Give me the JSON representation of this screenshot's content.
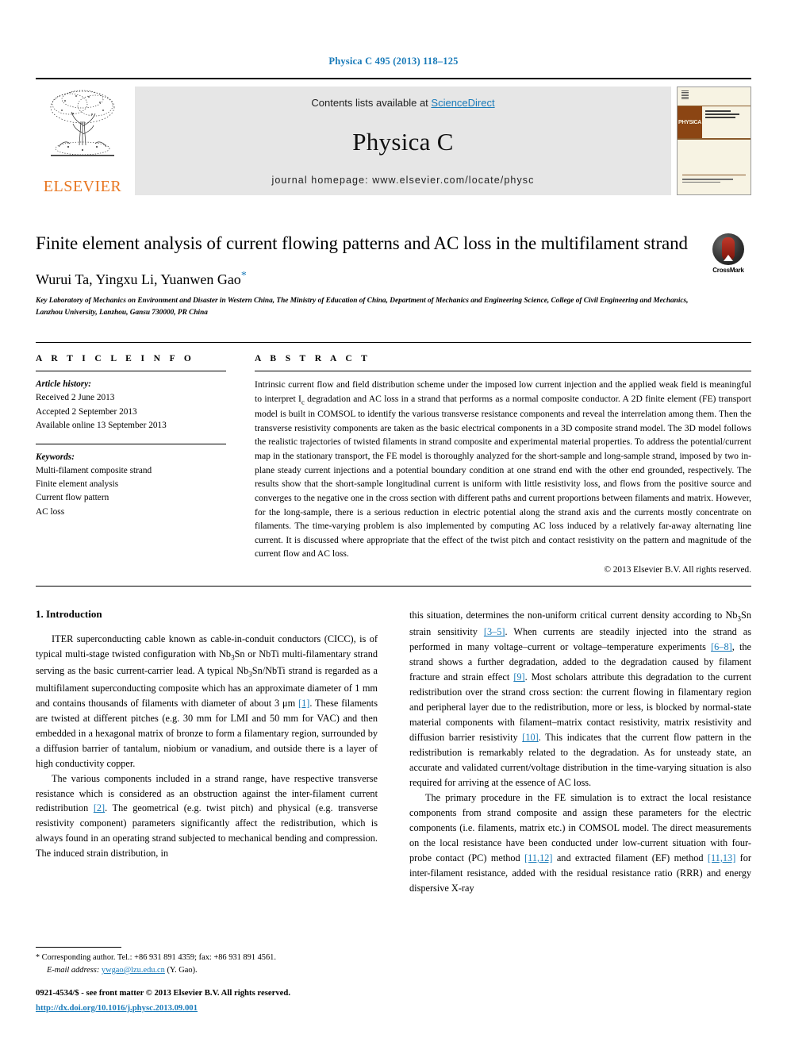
{
  "running_head": "Physica C 495 (2013) 118–125",
  "masthead": {
    "publisher": "ELSEVIER",
    "contents_prefix": "Contents lists available at ",
    "sciencedirect": "ScienceDirect",
    "journal_title": "Physica C",
    "homepage": "journal homepage: www.elsevier.com/locate/physc",
    "cover_brand": "PHYSICA",
    "accent_blue": "#1a7bb9",
    "elsevier_orange": "#E87722",
    "cover_brown": "#8B4513"
  },
  "article": {
    "title": "Finite element analysis of current flowing patterns and AC loss in the multifilament strand",
    "authors": "Wurui Ta, Yingxu Li, Yuanwen Gao",
    "corresponding_marker": "*",
    "affiliation": "Key Laboratory of Mechanics on Environment and Disaster in Western China, The Ministry of Education of China, Department of Mechanics and Engineering Science, College of Civil Engineering and Mechanics, Lanzhou University, Lanzhou, Gansu 730000, PR China",
    "crossmark_label": "CrossMark"
  },
  "article_info": {
    "heading": "A R T I C L E    I N F O",
    "history_label": "Article history:",
    "history": [
      "Received 2 June 2013",
      "Accepted 2 September 2013",
      "Available online 13 September 2013"
    ],
    "keywords_label": "Keywords:",
    "keywords": [
      "Multi-filament composite strand",
      "Finite element analysis",
      "Current flow pattern",
      "AC loss"
    ]
  },
  "abstract": {
    "heading": "A B S T R A C T",
    "part1": "Intrinsic current flow and field distribution scheme under the imposed low current injection and the applied weak field is meaningful to interpret I",
    "sub1": "c",
    "part2": " degradation and AC loss in a strand that performs as a normal composite conductor. A 2D finite element (FE) transport model is built in COMSOL to identify the various transverse resistance components and reveal the interrelation among them. Then the transverse resistivity components are taken as the basic electrical components in a 3D composite strand model. The 3D model follows the realistic trajectories of twisted filaments in strand composite and experimental material properties. To address the potential/current map in the stationary transport, the FE model is thoroughly analyzed for the short-sample and long-sample strand, imposed by two in-plane steady current injections and a potential boundary condition at one strand end with the other end grounded, respectively. The results show that the short-sample longitudinal current is uniform with little resistivity loss, and flows from the positive source and converges to the negative one in the cross section with different paths and current proportions between filaments and matrix. However, for the long-sample, there is a serious reduction in electric potential along the strand axis and the currents mostly concentrate on filaments. The time-varying problem is also implemented by computing AC loss induced by a relatively far-away alternating line current. It is discussed where appropriate that the effect of the twist pitch and contact resistivity on the pattern and magnitude of the current flow and AC loss.",
    "copyright": "© 2013 Elsevier B.V. All rights reserved."
  },
  "introduction": {
    "heading": "1. Introduction",
    "left_p1_a": "ITER superconducting cable known as cable-in-conduit conductors (CICC), is of typical multi-stage twisted configuration with Nb",
    "left_p1_sub": "3",
    "left_p1_b": "Sn or NbTi multi-filamentary strand serving as the basic current-carrier lead. A typical Nb",
    "left_p1_sub2": "3",
    "left_p1_c": "Sn/NbTi strand is regarded as a multifilament superconducting composite which has an approximate diameter of 1 mm and contains thousands of filaments with diameter of about 3 μm ",
    "left_p1_cite": "[1]",
    "left_p1_d": ". These filaments are twisted at different pitches (e.g. 30 mm for LMI and 50 mm for VAC) and then embedded in a hexagonal matrix of bronze to form a filamentary region, surrounded by a diffusion barrier of tantalum, niobium or vanadium, and outside there is a layer of high conductivity copper.",
    "left_p2_a": "The various components included in a strand range, have respective transverse resistance which is considered as an obstruction against the inter-filament current redistribution ",
    "left_p2_cite": "[2]",
    "left_p2_b": ". The geometrical (e.g. twist pitch) and physical (e.g. transverse resistivity component) parameters significantly affect the redistribution, which is always found in an operating strand subjected to mechanical bending and compression. The induced strain distribution, in",
    "right_p1_a": "this situation, determines the non-uniform critical current density according to Nb",
    "right_p1_sub": "3",
    "right_p1_b": "Sn strain sensitivity ",
    "right_p1_cite1": "[3–5]",
    "right_p1_c": ". When currents are steadily injected into the strand as performed in many voltage–current or voltage–temperature experiments ",
    "right_p1_cite2": "[6–8]",
    "right_p1_d": ", the strand shows a further degradation, added to the degradation caused by filament fracture and strain effect ",
    "right_p1_cite3": "[9]",
    "right_p1_e": ". Most scholars attribute this degradation to the current redistribution over the strand cross section: the current flowing in filamentary region and peripheral layer due to the redistribution, more or less, is blocked by normal-state material components with filament–matrix contact resistivity, matrix resistivity and diffusion barrier resistivity ",
    "right_p1_cite4": "[10]",
    "right_p1_f": ". This indicates that the current flow pattern in the redistribution is remarkably related to the degradation. As for unsteady state, an accurate and validated current/voltage distribution in the time-varying situation is also required for arriving at the essence of AC loss.",
    "right_p2_a": "The primary procedure in the FE simulation is to extract the local resistance components from strand composite and assign these parameters for the electric components (i.e. filaments, matrix etc.) in COMSOL model. The direct measurements on the local resistance have been conducted under low-current situation with four-probe contact (PC) method ",
    "right_p2_cite1": "[11,12]",
    "right_p2_b": " and extracted filament (EF) method ",
    "right_p2_cite2": "[11,13]",
    "right_p2_c": " for inter-filament resistance, added with the residual resistance ratio (RRR) and energy dispersive X-ray"
  },
  "footnote": {
    "star": "*",
    "corresponding": " Corresponding author. Tel.: +86 931 891 4359; fax: +86 931 891 4561.",
    "email_label": "E-mail address:",
    "email": "ywgao@lzu.edu.cn",
    "email_suffix": " (Y. Gao)."
  },
  "footer": {
    "issn_line": "0921-4534/$ - see front matter © 2013 Elsevier B.V. All rights reserved.",
    "doi": "http://dx.doi.org/10.1016/j.physc.2013.09.001"
  }
}
